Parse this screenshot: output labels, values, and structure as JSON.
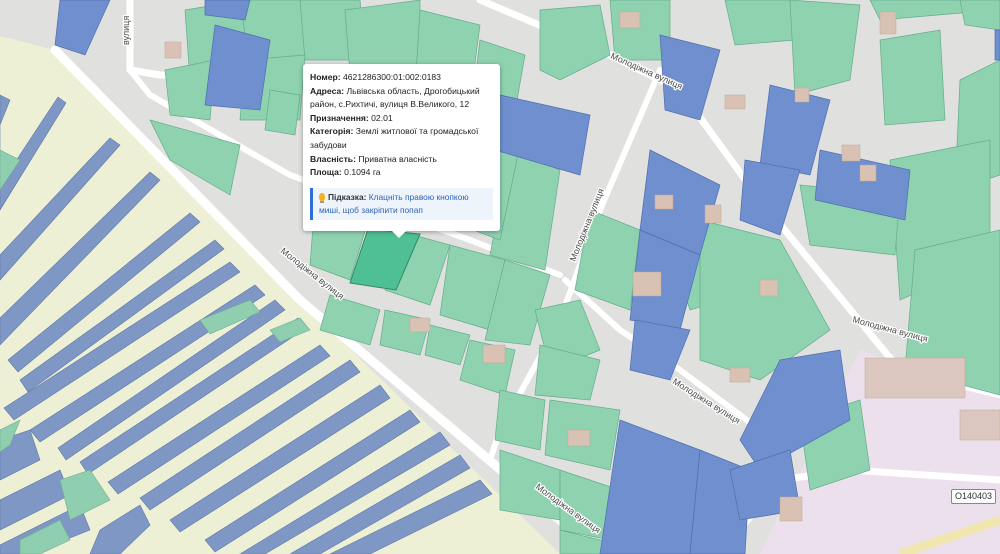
{
  "map": {
    "colors": {
      "land": "#e0e0de",
      "agri": "#eef0d6",
      "parcel_green": "#8ed2b0",
      "parcel_blue": "#6f8fce",
      "selected": "#4fbf95",
      "building": "#d9c2b3",
      "industrial": "#ece0ec",
      "road": "#ffffff"
    },
    "street_labels": [
      "вулиця",
      "Молодіжна вулиця",
      "Молодіжна вулиця",
      "Молодіжна вулиця",
      "Молодіжна вулиця",
      "Молодіжна вулиця",
      "Молодіжна вулиця"
    ],
    "road_ref": "O140403"
  },
  "popup": {
    "number_label": "Номер:",
    "number_value": "4621286300:01:002:0183",
    "address_label": "Адреса:",
    "address_value": "Львівська область, Дрогобицький район, с.Рихтичі, вулиця В.Великого, 12",
    "purpose_label": "Призначення:",
    "purpose_value": "02.01",
    "category_label": "Категорія:",
    "category_value": "Землі житлової та громадської забудови",
    "ownership_label": "Власність:",
    "ownership_value": "Приватна власність",
    "area_label": "Площа:",
    "area_value": "0.1094 га",
    "hint_icon": "lightbulb-icon",
    "hint_label": "Підказка:",
    "hint_text": "Клацніть правою кнопкою миші, щоб закріпити попап"
  }
}
